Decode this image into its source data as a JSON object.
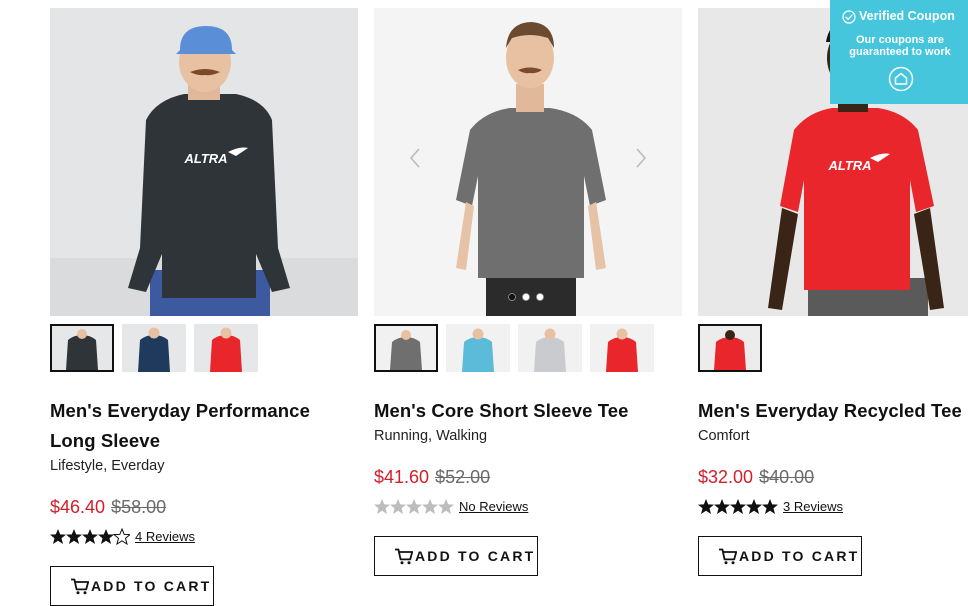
{
  "coupon": {
    "title": "Verified Coupon",
    "message": "Our coupons are guaranteed to work"
  },
  "products": [
    {
      "name": "Men's Everyday Performance Long Sleeve",
      "category": "Lifestyle, Everday",
      "sale_price": "$46.40",
      "original_price": "$58.00",
      "rating": 4.5,
      "reviews_label": "4 Reviews",
      "cart_label": "ADD TO CART",
      "logo_text": "ALTRA"
    },
    {
      "name": "Men's Core Short Sleeve Tee",
      "category": "Running, Walking",
      "sale_price": "$41.60",
      "original_price": "$52.00",
      "rating": 0,
      "reviews_label": "No Reviews",
      "cart_label": "ADD TO CART",
      "carousel_slides": 3,
      "carousel_active": 1
    },
    {
      "name": "Men's Everyday Recycled Tee",
      "category": "Comfort",
      "sale_price": "$32.00",
      "original_price": "$40.00",
      "rating": 5,
      "reviews_label": "3 Reviews",
      "cart_label": "ADD TO CART",
      "logo_text": "ALTRA"
    }
  ],
  "colors": {
    "sale": "#d0202a",
    "coupon": "#45c6dd",
    "tee_charcoal": "#2f3439",
    "tee_navy": "#1f3a5c",
    "tee_red": "#e8262b",
    "tee_gray": "#6f6f6f",
    "tee_sky": "#5bbbd9",
    "tee_light_gray": "#c9cbcf"
  }
}
